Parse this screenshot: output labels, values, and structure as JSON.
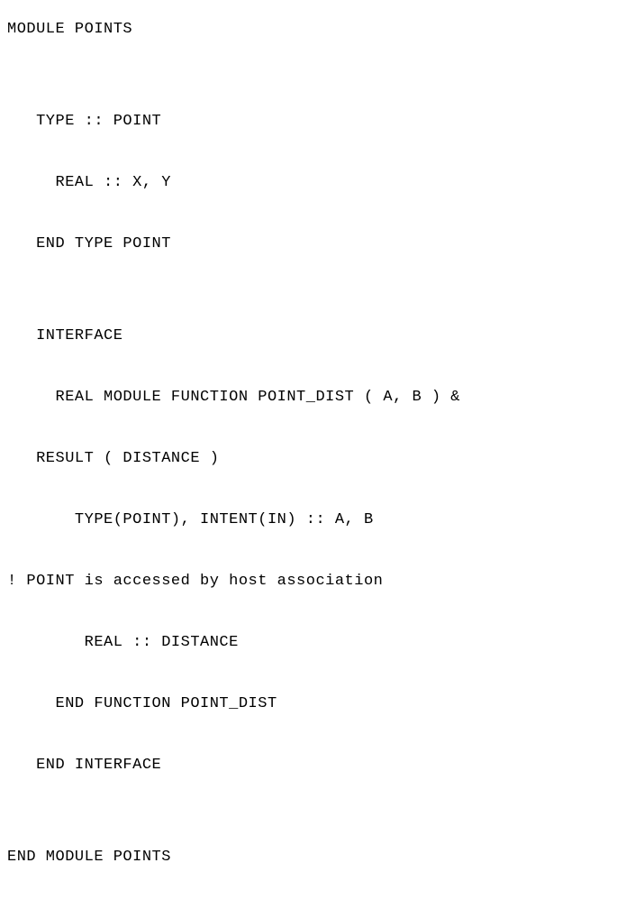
{
  "code": {
    "lines": [
      "MODULE POINTS",
      "",
      "   TYPE :: POINT",
      "     REAL :: X, Y",
      "   END TYPE POINT",
      "",
      "   INTERFACE",
      "     REAL MODULE FUNCTION POINT_DIST ( A, B ) &",
      "   RESULT ( DISTANCE )",
      "       TYPE(POINT), INTENT(IN) :: A, B",
      "! POINT is accessed by host association",
      "        REAL :: DISTANCE",
      "     END FUNCTION POINT_DIST",
      "   END INTERFACE",
      "",
      "END MODULE POINTS"
    ]
  }
}
